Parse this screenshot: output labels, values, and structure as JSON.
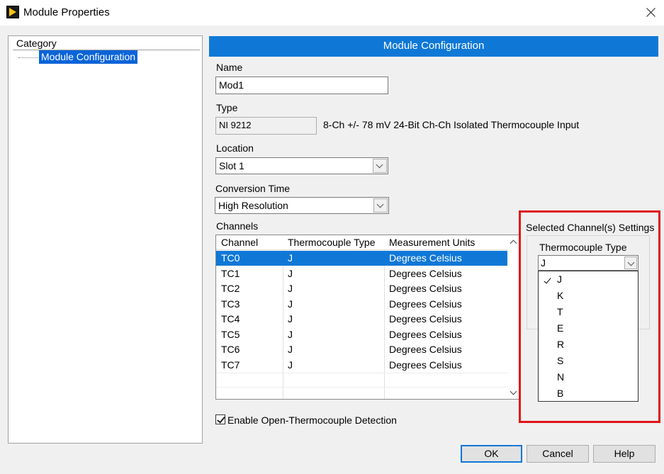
{
  "window": {
    "title": "Module Properties"
  },
  "category": {
    "header": "Category",
    "items": [
      {
        "label": "Module Configuration",
        "selected": true
      }
    ]
  },
  "banner": "Module Configuration",
  "form": {
    "name_label": "Name",
    "name_value": "Mod1",
    "type_label": "Type",
    "type_value": "NI 9212",
    "type_description": "8-Ch +/- 78 mV 24-Bit Ch-Ch Isolated Thermocouple Input",
    "location_label": "Location",
    "location_value": "Slot 1",
    "conversion_label": "Conversion Time",
    "conversion_value": "High Resolution",
    "channels_label": "Channels"
  },
  "channels": {
    "headers": [
      "Channel",
      "Thermocouple Type",
      "Measurement Units"
    ],
    "rows": [
      {
        "channel": "TC0",
        "type": "J",
        "units": "Degrees Celsius",
        "selected": true
      },
      {
        "channel": "TC1",
        "type": "J",
        "units": "Degrees Celsius"
      },
      {
        "channel": "TC2",
        "type": "J",
        "units": "Degrees Celsius"
      },
      {
        "channel": "TC3",
        "type": "J",
        "units": "Degrees Celsius"
      },
      {
        "channel": "TC4",
        "type": "J",
        "units": "Degrees Celsius"
      },
      {
        "channel": "TC5",
        "type": "J",
        "units": "Degrees Celsius"
      },
      {
        "channel": "TC6",
        "type": "J",
        "units": "Degrees Celsius"
      },
      {
        "channel": "TC7",
        "type": "J",
        "units": "Degrees Celsius"
      }
    ]
  },
  "open_tc_detection": {
    "label": "Enable Open-Thermocouple Detection",
    "checked": true
  },
  "selected_settings": {
    "title": "Selected Channel(s) Settings",
    "thermocouple_label": "Thermocouple Type",
    "thermocouple_value": "J",
    "options": [
      "J",
      "K",
      "T",
      "E",
      "R",
      "S",
      "N",
      "B"
    ],
    "checked_option": "J"
  },
  "buttons": {
    "ok": "OK",
    "cancel": "Cancel",
    "help": "Help"
  },
  "colors": {
    "accent": "#0f78d7",
    "highlight_border": "#e0151a",
    "selection": "#0a64d8"
  },
  "icons": {
    "app": "labview-play-icon",
    "close": "close-icon",
    "combo": "chevron-down-icon",
    "scroll_up": "chevron-up-icon",
    "scroll_down": "chevron-down-icon",
    "check": "checkmark-icon"
  }
}
